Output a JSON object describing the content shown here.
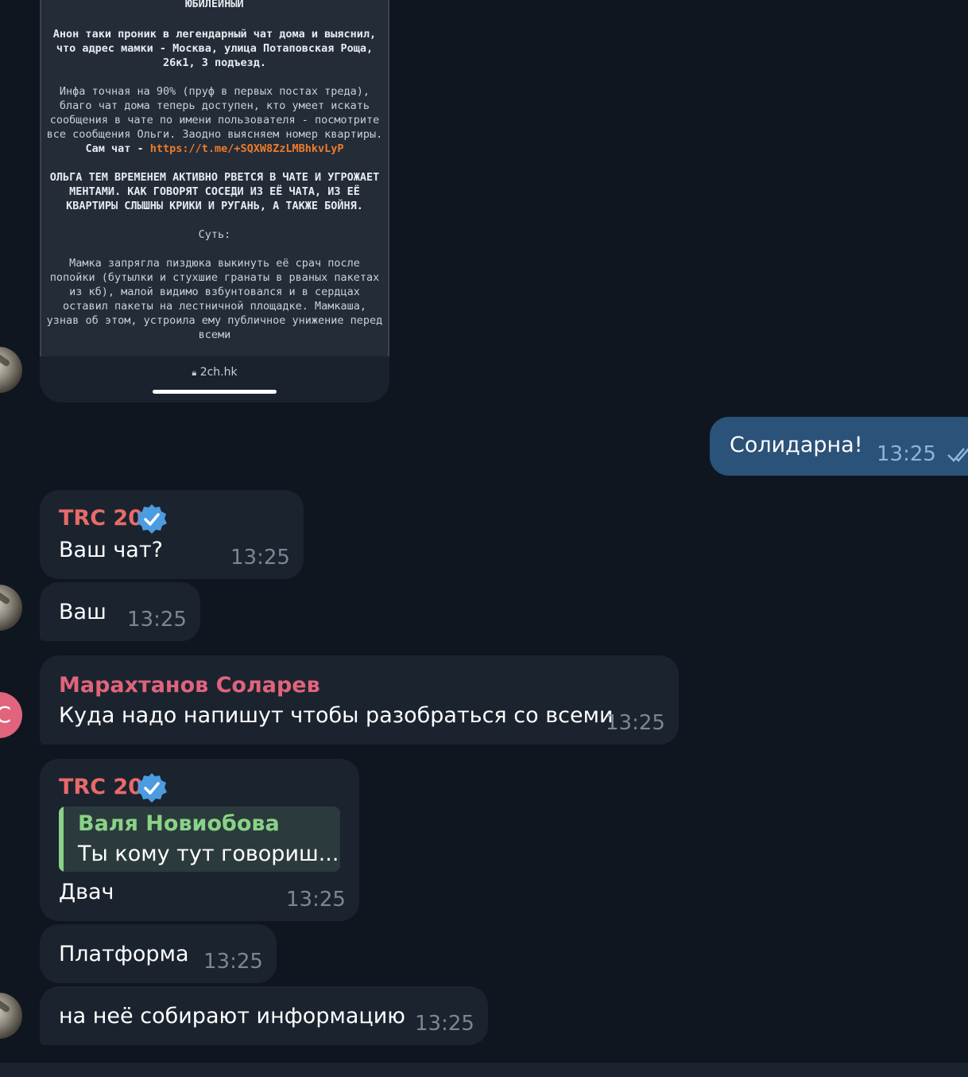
{
  "preview": {
    "heading": "ЮБИЛЕЙНЫЙ",
    "para1": "Анон таки проник в легендарный чат дома и выяснил, что адрес мамки - Москва, улица Потаповская Роща, 26к1, 3 подъезд.",
    "para2": "Инфа точная на 90% (пруф в первых постах треда), благо чат дома теперь доступен, кто умеет искать сообщения в чате по имени пользователя - посмотрите все сообщения Ольги. Заодно выясняем номер квартиры.",
    "chat_label": "Сам чат - ",
    "chat_link": "https://t.me/+SQXW8ZzLMBhkvLyP",
    "para3": "ОЛЬГА ТЕМ ВРЕМЕНЕМ АКТИВНО РВЕТСЯ В ЧАТЕ И УГРОЖАЕТ МЕНТАМИ. КАК ГОВОРЯТ СОСЕДИ ИЗ ЕЁ ЧАТА, ИЗ ЕЁ КВАРТИРЫ СЛЫШНЫ КРИКИ И РУГАНЬ, А ТАКЖЕ БОЙНЯ.",
    "summary_label": "Суть:",
    "para4": "Мамка запрягла пиздюка выкинуть её срач после попойки (бутылки и стухшие гранаты в рваных пакетах из кб), малой видимо взбунтовался и в сердцах оставил пакеты на лестничной площадке. Мамкаша, узнав об этом, устроила ему публичное унижение перед всеми",
    "url": "2ch.hk"
  },
  "messages": {
    "out1": {
      "text": "Солидарна!",
      "time": "13:25"
    },
    "m1": {
      "sender": "TRC 20",
      "text": "Ваш чат?",
      "time": "13:25"
    },
    "m2": {
      "text": "Ваш",
      "time": "13:25"
    },
    "m3": {
      "sender": "Марахтанов Соларев",
      "text": "Куда надо напишут чтобы разобраться со всеми",
      "time": "13:25",
      "avatar_initial": "С"
    },
    "m4": {
      "sender": "TRC 20",
      "reply_name": "Валя Новиобова",
      "reply_text": "Ты кому тут говориш...",
      "text": "Двач",
      "time": "13:25"
    },
    "m5": {
      "text": "Платформа",
      "time": "13:25"
    },
    "m6": {
      "text": "на неё собирают информацию",
      "time": "13:25"
    }
  },
  "colors": {
    "background": "#0f1620",
    "bubble_in": "#1b232e",
    "bubble_out": "#2b5278",
    "sender_trc": "#e86a6a",
    "sender_marah": "#e0647c",
    "reply_accent": "#89d287",
    "verified": "#4c9ce2"
  },
  "icons": [
    "lock-icon",
    "verified-badge-icon",
    "double-check-icon"
  ]
}
